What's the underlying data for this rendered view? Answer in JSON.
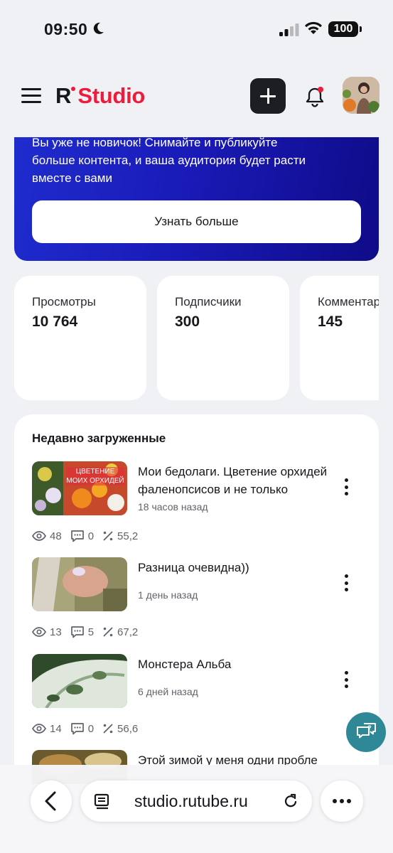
{
  "status_bar": {
    "time": "09:50",
    "battery": "100"
  },
  "header": {
    "logo_r": "R",
    "logo_studio": "Studio"
  },
  "promo": {
    "text": "Вы уже не новичок! Снимайте и публикуйте больше контента, и ваша аудитория будет расти вместе с вами",
    "button": "Узнать больше"
  },
  "stats": [
    {
      "label": "Просмотры",
      "value": "10 764"
    },
    {
      "label": "Подписчики",
      "value": "300"
    },
    {
      "label": "Комментарии",
      "value": "145"
    }
  ],
  "recent": {
    "title": "Недавно загруженные",
    "videos": [
      {
        "title": "Мои бедолаги. Цветение орхидей фаленопсисов и не только",
        "thumb_caption": "ЦВЕТЕНИЕ МОИХ ОРХИДЕЙ",
        "time": "18 часов назад",
        "views": "48",
        "comments": "0",
        "percent": "55,2"
      },
      {
        "title": "Разница очевидна))",
        "time": "1 день назад",
        "views": "13",
        "comments": "5",
        "percent": "67,2"
      },
      {
        "title": "Монстера Альба",
        "time": "6 дней назад",
        "views": "14",
        "comments": "0",
        "percent": "56,6"
      },
      {
        "title": "Этой зимой у меня одни пробле"
      }
    ]
  },
  "browser": {
    "url": "studio.rutube.ru"
  },
  "colors": {
    "brand_red": "#ee1c3b",
    "promo_blue": "#1a1bb8",
    "help_teal": "#2f8896"
  },
  "icons": [
    "menu-icon",
    "plus-icon",
    "bell-icon",
    "eye-icon",
    "comment-icon",
    "percent-icon",
    "more-vertical-icon",
    "help-chat-icon",
    "back-icon",
    "tabs-icon",
    "reload-icon",
    "more-horizontal-icon"
  ]
}
